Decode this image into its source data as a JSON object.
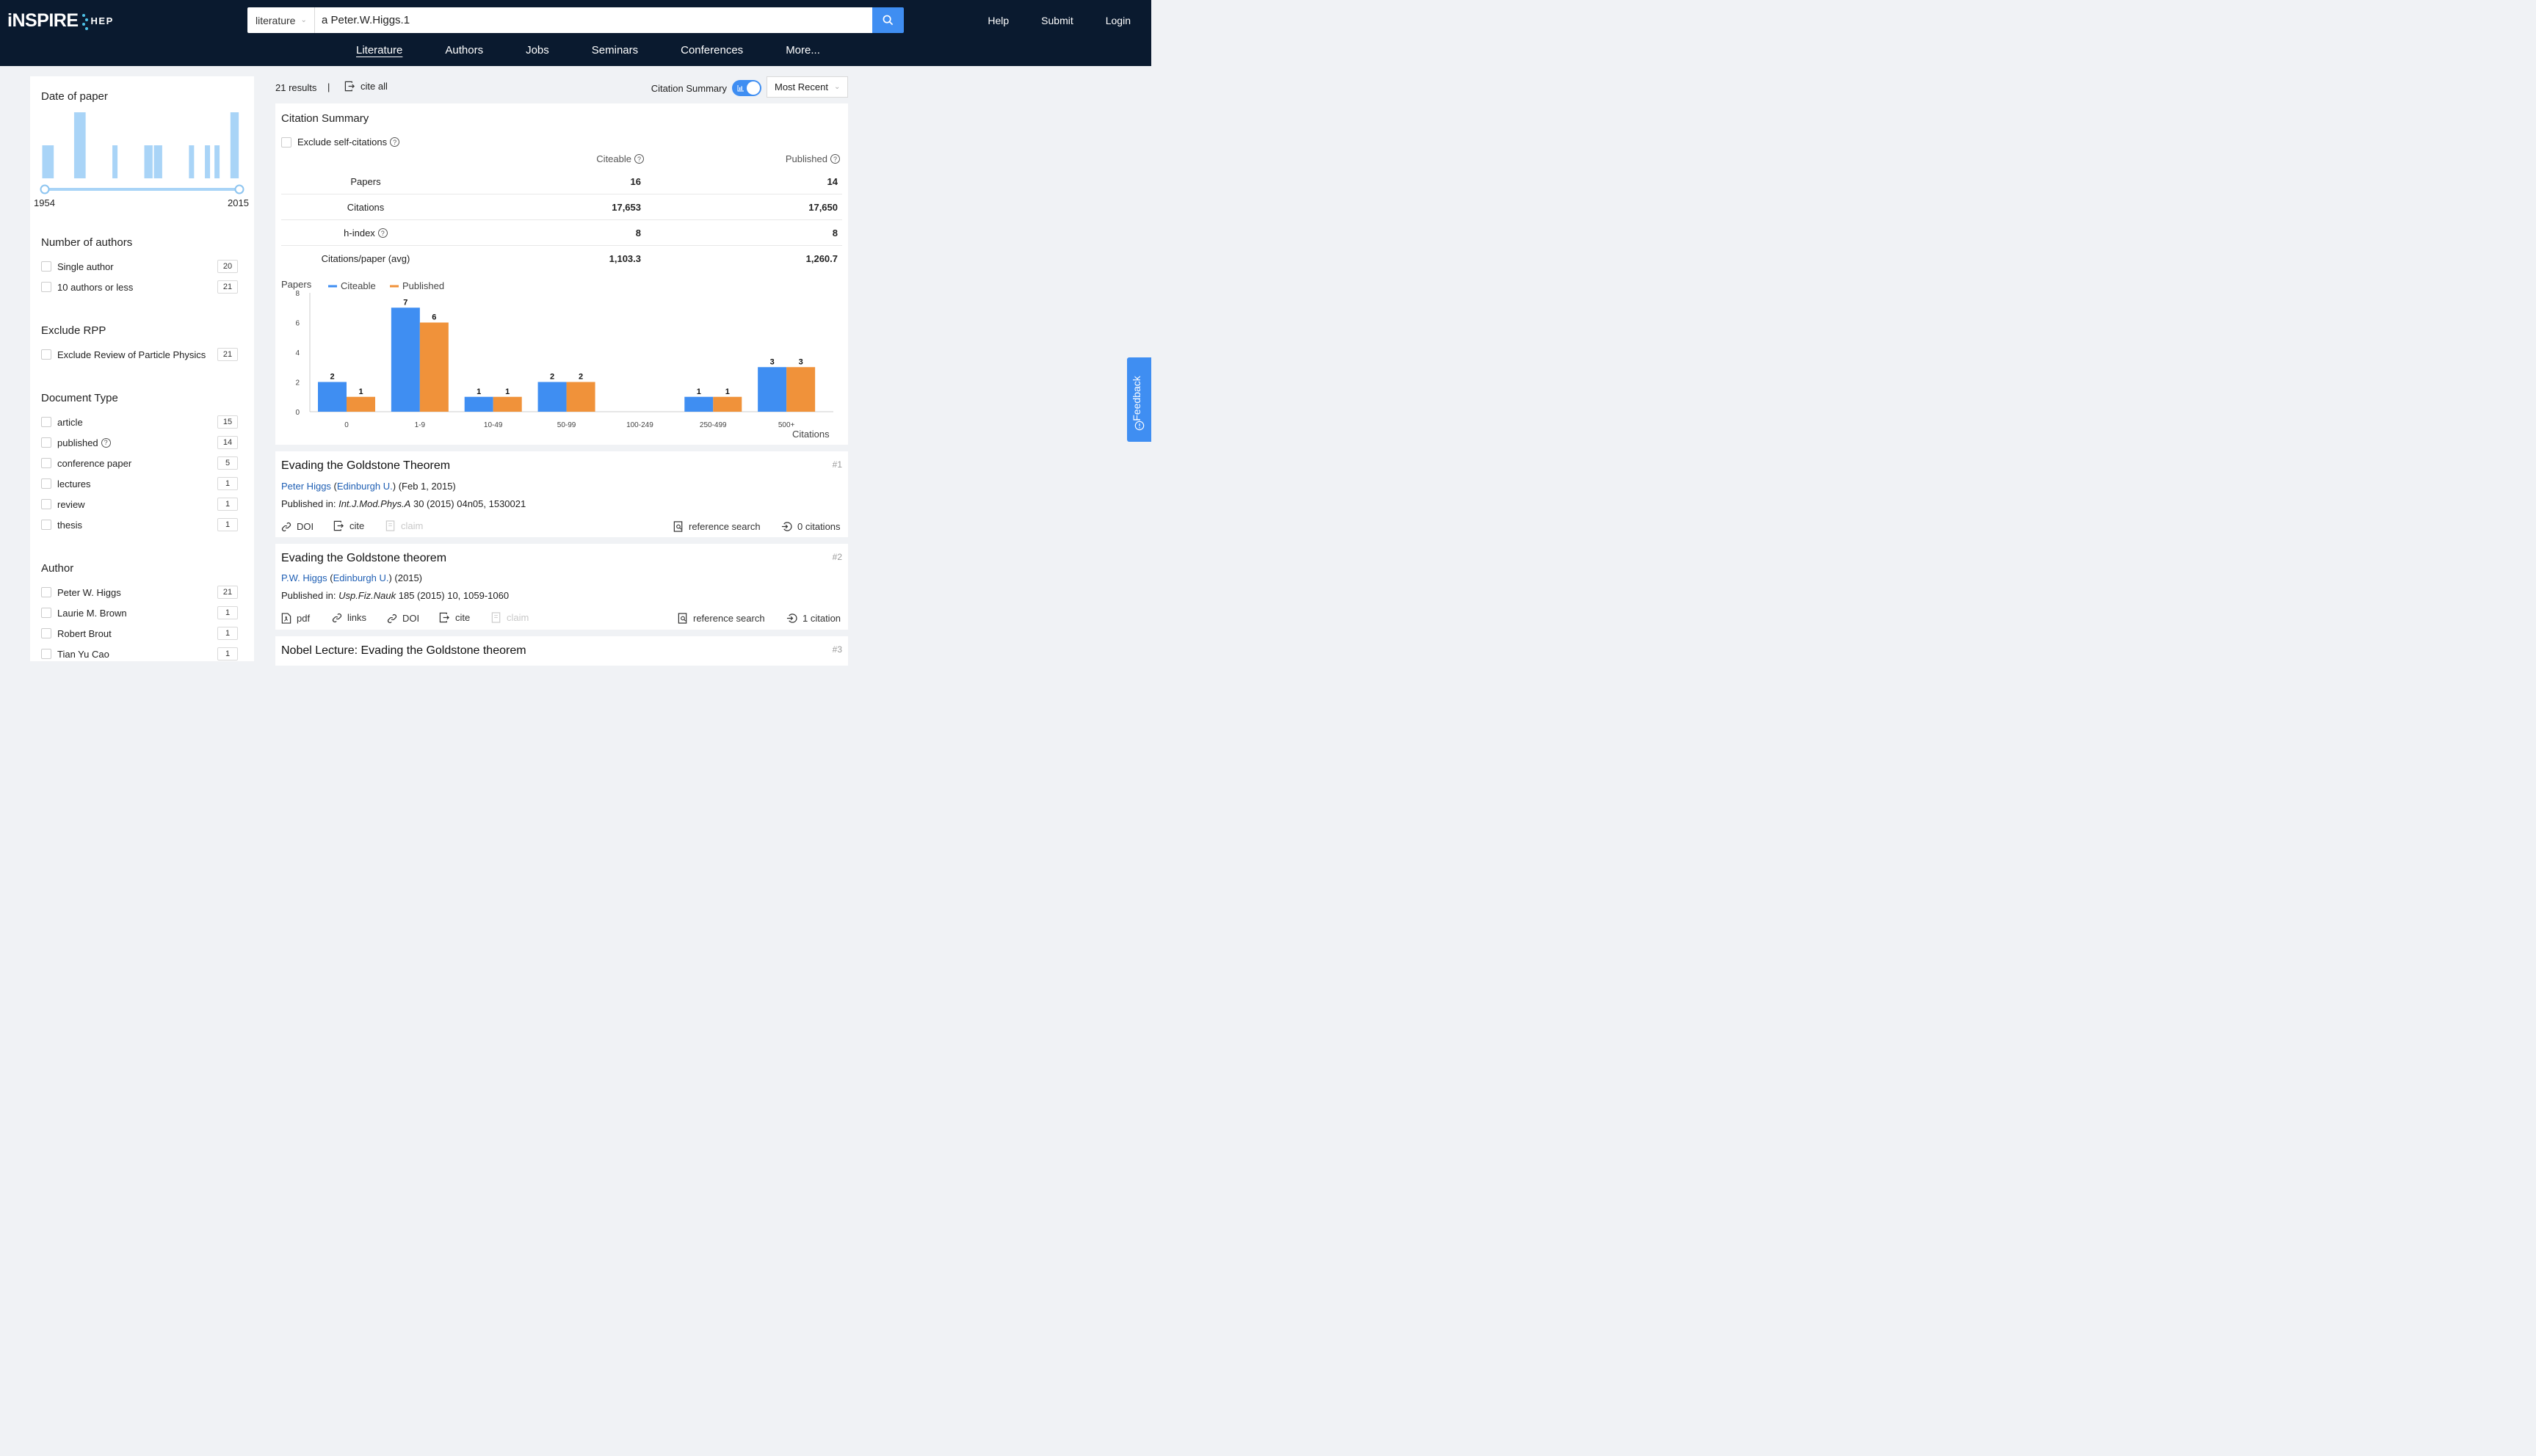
{
  "header": {
    "logo_main": "iNSPIRE",
    "logo_sub": "HEP",
    "search_scope": "literature",
    "search_query": "a Peter.W.Higgs.1",
    "links": [
      "Help",
      "Submit",
      "Login"
    ],
    "nav": [
      "Literature",
      "Authors",
      "Jobs",
      "Seminars",
      "Conferences",
      "More..."
    ]
  },
  "sidebar": {
    "date_title": "Date of paper",
    "date_from": "1954",
    "date_to": "2015",
    "date_histogram": [
      {
        "year": 1954,
        "level": 0.5
      },
      {
        "year": 1955,
        "level": 0.5
      },
      {
        "year": 1956,
        "level": 0.5
      },
      {
        "year": 1964,
        "level": 1.0
      },
      {
        "year": 1965,
        "level": 1.0
      },
      {
        "year": 1966,
        "level": 1.0
      },
      {
        "year": 1976,
        "level": 0.5
      },
      {
        "year": 1986,
        "level": 0.5
      },
      {
        "year": 1987,
        "level": 0.5
      },
      {
        "year": 1989,
        "level": 0.5
      },
      {
        "year": 1990,
        "level": 0.5
      },
      {
        "year": 2000,
        "level": 0.5
      },
      {
        "year": 2005,
        "level": 0.5
      },
      {
        "year": 2008,
        "level": 0.5
      },
      {
        "year": 2013,
        "level": 1.0
      },
      {
        "year": 2014,
        "level": 1.0
      }
    ],
    "authors_title": "Number of authors",
    "authors_items": [
      {
        "label": "Single author",
        "count": "20"
      },
      {
        "label": "10 authors or less",
        "count": "21"
      }
    ],
    "rpp_title": "Exclude RPP",
    "rpp_items": [
      {
        "label": "Exclude Review of Particle Physics",
        "count": "21"
      }
    ],
    "doctype_title": "Document Type",
    "doctype_items": [
      {
        "label": "article",
        "count": "15"
      },
      {
        "label": "published",
        "count": "14"
      },
      {
        "label": "conference paper",
        "count": "5"
      },
      {
        "label": "lectures",
        "count": "1"
      },
      {
        "label": "review",
        "count": "1"
      },
      {
        "label": "thesis",
        "count": "1"
      }
    ],
    "author_title": "Author",
    "author_items": [
      {
        "label": "Peter W. Higgs",
        "count": "21"
      },
      {
        "label": "Laurie M. Brown",
        "count": "1"
      },
      {
        "label": "Robert Brout",
        "count": "1"
      },
      {
        "label": "Tian Yu Cao",
        "count": "1"
      }
    ]
  },
  "results_header": {
    "count": "21 results",
    "separator": "|",
    "cite_all": "cite all",
    "toggle_label": "Citation Summary",
    "sort": "Most Recent"
  },
  "citation_summary": {
    "title": "Citation Summary",
    "exclude_self": "Exclude self-citations",
    "col_citeable": "Citeable",
    "col_published": "Published",
    "rows": [
      {
        "label": "Papers",
        "citeable": "16",
        "published": "14"
      },
      {
        "label": "Citations",
        "citeable": "17,653",
        "published": "17,650"
      },
      {
        "label": "h-index",
        "citeable": "8",
        "published": "8"
      },
      {
        "label": "Citations/paper (avg)",
        "citeable": "1,103.3",
        "published": "1,260.7"
      }
    ]
  },
  "chart_data": {
    "type": "bar",
    "title": "",
    "ylabel": "Papers",
    "xlabel": "Citations",
    "ylim": [
      0,
      8
    ],
    "yticks": [
      0,
      2,
      4,
      6,
      8
    ],
    "categories": [
      "0",
      "1-9",
      "10-49",
      "50-99",
      "100-249",
      "250-499",
      "500+"
    ],
    "series": [
      {
        "name": "Citeable",
        "color": "#3f8ef2",
        "values": [
          2,
          7,
          1,
          2,
          0,
          1,
          3
        ]
      },
      {
        "name": "Published",
        "color": "#f0923a",
        "values": [
          1,
          6,
          1,
          2,
          0,
          1,
          3
        ]
      }
    ],
    "legend": "top-left",
    "grid": false
  },
  "results": [
    {
      "title": "Evading the Goldstone Theorem",
      "num": "#1",
      "author": "Peter Higgs",
      "affiliation": "Edinburgh U.",
      "date": "(Feb 1, 2015)",
      "pub_prefix": "Published in:",
      "journal": "Int.J.Mod.Phys.A",
      "pub_rest": "30 (2015) 04n05, 1530021",
      "actions": [
        "DOI",
        "cite",
        "claim"
      ],
      "ref_search": "reference search",
      "citations": "0 citations"
    },
    {
      "title": "Evading the Goldstone theorem",
      "num": "#2",
      "author": "P.W. Higgs",
      "affiliation": "Edinburgh U.",
      "date": "(2015)",
      "pub_prefix": "Published in:",
      "journal": "Usp.Fiz.Nauk",
      "pub_rest": "185 (2015) 10, 1059-1060",
      "actions": [
        "pdf",
        "links",
        "DOI",
        "cite",
        "claim"
      ],
      "ref_search": "reference search",
      "citations": "1 citation"
    },
    {
      "title": "Nobel Lecture: Evading the Goldstone theorem",
      "num": "#3"
    }
  ],
  "feedback": "Feedback",
  "colors": {
    "header": "#0a1a2f",
    "accent": "#3f8ef2",
    "published": "#f0923a",
    "link": "#1f5fb4"
  }
}
